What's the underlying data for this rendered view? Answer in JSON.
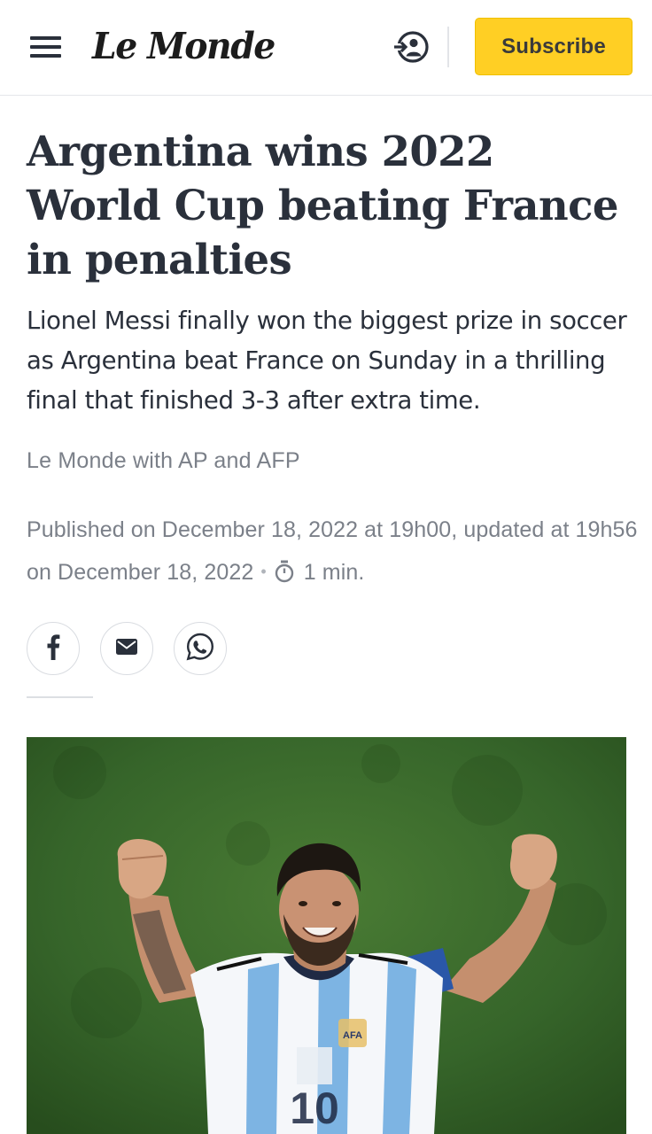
{
  "header": {
    "logo": "Le Monde",
    "subscribe_label": "Subscribe"
  },
  "icons": {
    "menu": "hamburger-menu-icon",
    "login": "login-icon",
    "timer": "stopwatch-icon",
    "facebook": "facebook-icon",
    "email": "email-icon",
    "whatsapp": "whatsapp-icon"
  },
  "article": {
    "headline": "Argentina wins 2022 World Cup beating France in penalties",
    "dek": "Lionel Messi finally won the biggest prize in soccer as Argentina beat France on Sunday in a thrilling final that finished 3-3 after extra time.",
    "byline": "Le Monde with AP and AFP",
    "published": "Published on December 18, 2022 at 19h00, updated at 19h56 on December 18, 2022",
    "separator": "•",
    "read_time": "1 min.",
    "photo_number": "10"
  },
  "colors": {
    "subscribe_bg": "#ffcf24",
    "text_primary": "#2a303b",
    "text_muted": "#7b8089",
    "albiceleste_blue": "#7db4e3"
  }
}
